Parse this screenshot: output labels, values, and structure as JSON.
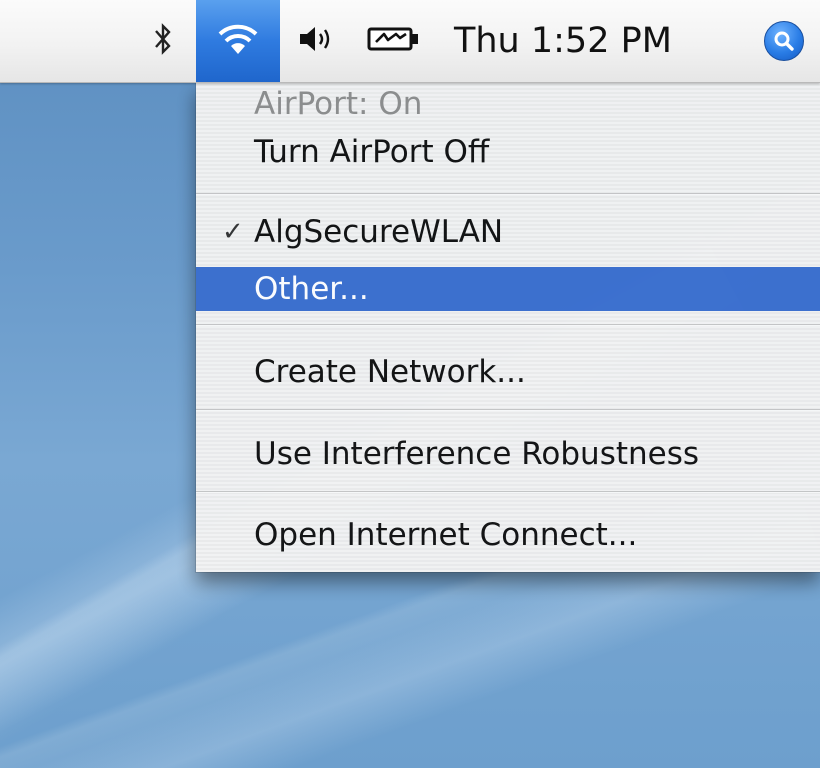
{
  "menubar": {
    "bluetooth_icon": "bluetooth-icon",
    "airport_icon": "wifi-icon",
    "volume_icon": "volume-icon",
    "battery_icon": "battery-charging-icon",
    "clock": "Thu 1:52 PM",
    "spotlight_icon": "search-icon",
    "airport_highlight_color": "#2f7be0"
  },
  "airport_menu": {
    "status": "AirPort: On",
    "toggle_label": "Turn AirPort Off",
    "networks": [
      {
        "label": "AlgSecureWLAN",
        "checked": true
      },
      {
        "label": "Other...",
        "checked": false,
        "highlighted": true
      }
    ],
    "create_network": "Create Network...",
    "interference": "Use Interference Robustness",
    "open_internet_connect": "Open Internet Connect...",
    "check_mark": "✓",
    "highlight_color": "#3b6fcf"
  }
}
